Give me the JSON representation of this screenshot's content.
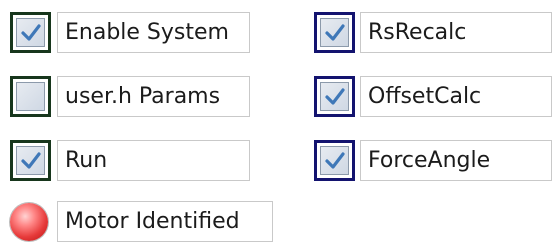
{
  "controls": {
    "enable_system": {
      "label": "Enable System",
      "checked": true
    },
    "user_h_params": {
      "label": "user.h Params",
      "checked": false
    },
    "run": {
      "label": "Run",
      "checked": true
    },
    "motor_identified": {
      "label": "Motor Identified",
      "led_state": "on",
      "led_color": "#e63a3a"
    },
    "rs_recalc": {
      "label": "RsRecalc",
      "checked": true
    },
    "offset_calc": {
      "label": "OffsetCalc",
      "checked": true
    },
    "force_angle": {
      "label": "ForceAngle",
      "checked": true
    }
  },
  "colors": {
    "left_checkbox_frame": "#17361c",
    "right_checkbox_frame": "#13136f",
    "check_mark": "#3f78b8"
  }
}
